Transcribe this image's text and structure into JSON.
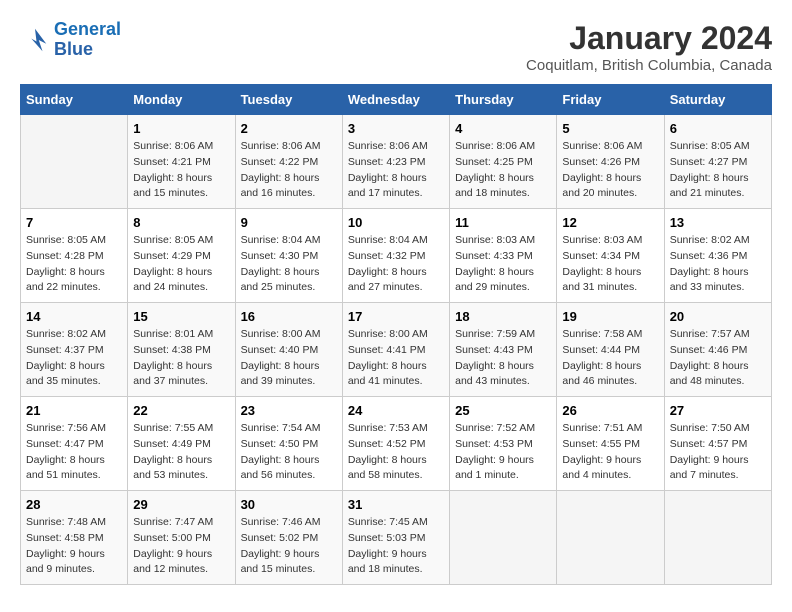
{
  "logo": {
    "line1": "General",
    "line2": "Blue"
  },
  "title": "January 2024",
  "subtitle": "Coquitlam, British Columbia, Canada",
  "days_of_week": [
    "Sunday",
    "Monday",
    "Tuesday",
    "Wednesday",
    "Thursday",
    "Friday",
    "Saturday"
  ],
  "weeks": [
    [
      {
        "day": "",
        "info": ""
      },
      {
        "day": "1",
        "info": "Sunrise: 8:06 AM\nSunset: 4:21 PM\nDaylight: 8 hours\nand 15 minutes."
      },
      {
        "day": "2",
        "info": "Sunrise: 8:06 AM\nSunset: 4:22 PM\nDaylight: 8 hours\nand 16 minutes."
      },
      {
        "day": "3",
        "info": "Sunrise: 8:06 AM\nSunset: 4:23 PM\nDaylight: 8 hours\nand 17 minutes."
      },
      {
        "day": "4",
        "info": "Sunrise: 8:06 AM\nSunset: 4:25 PM\nDaylight: 8 hours\nand 18 minutes."
      },
      {
        "day": "5",
        "info": "Sunrise: 8:06 AM\nSunset: 4:26 PM\nDaylight: 8 hours\nand 20 minutes."
      },
      {
        "day": "6",
        "info": "Sunrise: 8:05 AM\nSunset: 4:27 PM\nDaylight: 8 hours\nand 21 minutes."
      }
    ],
    [
      {
        "day": "7",
        "info": "Sunrise: 8:05 AM\nSunset: 4:28 PM\nDaylight: 8 hours\nand 22 minutes."
      },
      {
        "day": "8",
        "info": "Sunrise: 8:05 AM\nSunset: 4:29 PM\nDaylight: 8 hours\nand 24 minutes."
      },
      {
        "day": "9",
        "info": "Sunrise: 8:04 AM\nSunset: 4:30 PM\nDaylight: 8 hours\nand 25 minutes."
      },
      {
        "day": "10",
        "info": "Sunrise: 8:04 AM\nSunset: 4:32 PM\nDaylight: 8 hours\nand 27 minutes."
      },
      {
        "day": "11",
        "info": "Sunrise: 8:03 AM\nSunset: 4:33 PM\nDaylight: 8 hours\nand 29 minutes."
      },
      {
        "day": "12",
        "info": "Sunrise: 8:03 AM\nSunset: 4:34 PM\nDaylight: 8 hours\nand 31 minutes."
      },
      {
        "day": "13",
        "info": "Sunrise: 8:02 AM\nSunset: 4:36 PM\nDaylight: 8 hours\nand 33 minutes."
      }
    ],
    [
      {
        "day": "14",
        "info": "Sunrise: 8:02 AM\nSunset: 4:37 PM\nDaylight: 8 hours\nand 35 minutes."
      },
      {
        "day": "15",
        "info": "Sunrise: 8:01 AM\nSunset: 4:38 PM\nDaylight: 8 hours\nand 37 minutes."
      },
      {
        "day": "16",
        "info": "Sunrise: 8:00 AM\nSunset: 4:40 PM\nDaylight: 8 hours\nand 39 minutes."
      },
      {
        "day": "17",
        "info": "Sunrise: 8:00 AM\nSunset: 4:41 PM\nDaylight: 8 hours\nand 41 minutes."
      },
      {
        "day": "18",
        "info": "Sunrise: 7:59 AM\nSunset: 4:43 PM\nDaylight: 8 hours\nand 43 minutes."
      },
      {
        "day": "19",
        "info": "Sunrise: 7:58 AM\nSunset: 4:44 PM\nDaylight: 8 hours\nand 46 minutes."
      },
      {
        "day": "20",
        "info": "Sunrise: 7:57 AM\nSunset: 4:46 PM\nDaylight: 8 hours\nand 48 minutes."
      }
    ],
    [
      {
        "day": "21",
        "info": "Sunrise: 7:56 AM\nSunset: 4:47 PM\nDaylight: 8 hours\nand 51 minutes."
      },
      {
        "day": "22",
        "info": "Sunrise: 7:55 AM\nSunset: 4:49 PM\nDaylight: 8 hours\nand 53 minutes."
      },
      {
        "day": "23",
        "info": "Sunrise: 7:54 AM\nSunset: 4:50 PM\nDaylight: 8 hours\nand 56 minutes."
      },
      {
        "day": "24",
        "info": "Sunrise: 7:53 AM\nSunset: 4:52 PM\nDaylight: 8 hours\nand 58 minutes."
      },
      {
        "day": "25",
        "info": "Sunrise: 7:52 AM\nSunset: 4:53 PM\nDaylight: 9 hours\nand 1 minute."
      },
      {
        "day": "26",
        "info": "Sunrise: 7:51 AM\nSunset: 4:55 PM\nDaylight: 9 hours\nand 4 minutes."
      },
      {
        "day": "27",
        "info": "Sunrise: 7:50 AM\nSunset: 4:57 PM\nDaylight: 9 hours\nand 7 minutes."
      }
    ],
    [
      {
        "day": "28",
        "info": "Sunrise: 7:48 AM\nSunset: 4:58 PM\nDaylight: 9 hours\nand 9 minutes."
      },
      {
        "day": "29",
        "info": "Sunrise: 7:47 AM\nSunset: 5:00 PM\nDaylight: 9 hours\nand 12 minutes."
      },
      {
        "day": "30",
        "info": "Sunrise: 7:46 AM\nSunset: 5:02 PM\nDaylight: 9 hours\nand 15 minutes."
      },
      {
        "day": "31",
        "info": "Sunrise: 7:45 AM\nSunset: 5:03 PM\nDaylight: 9 hours\nand 18 minutes."
      },
      {
        "day": "",
        "info": ""
      },
      {
        "day": "",
        "info": ""
      },
      {
        "day": "",
        "info": ""
      }
    ]
  ]
}
